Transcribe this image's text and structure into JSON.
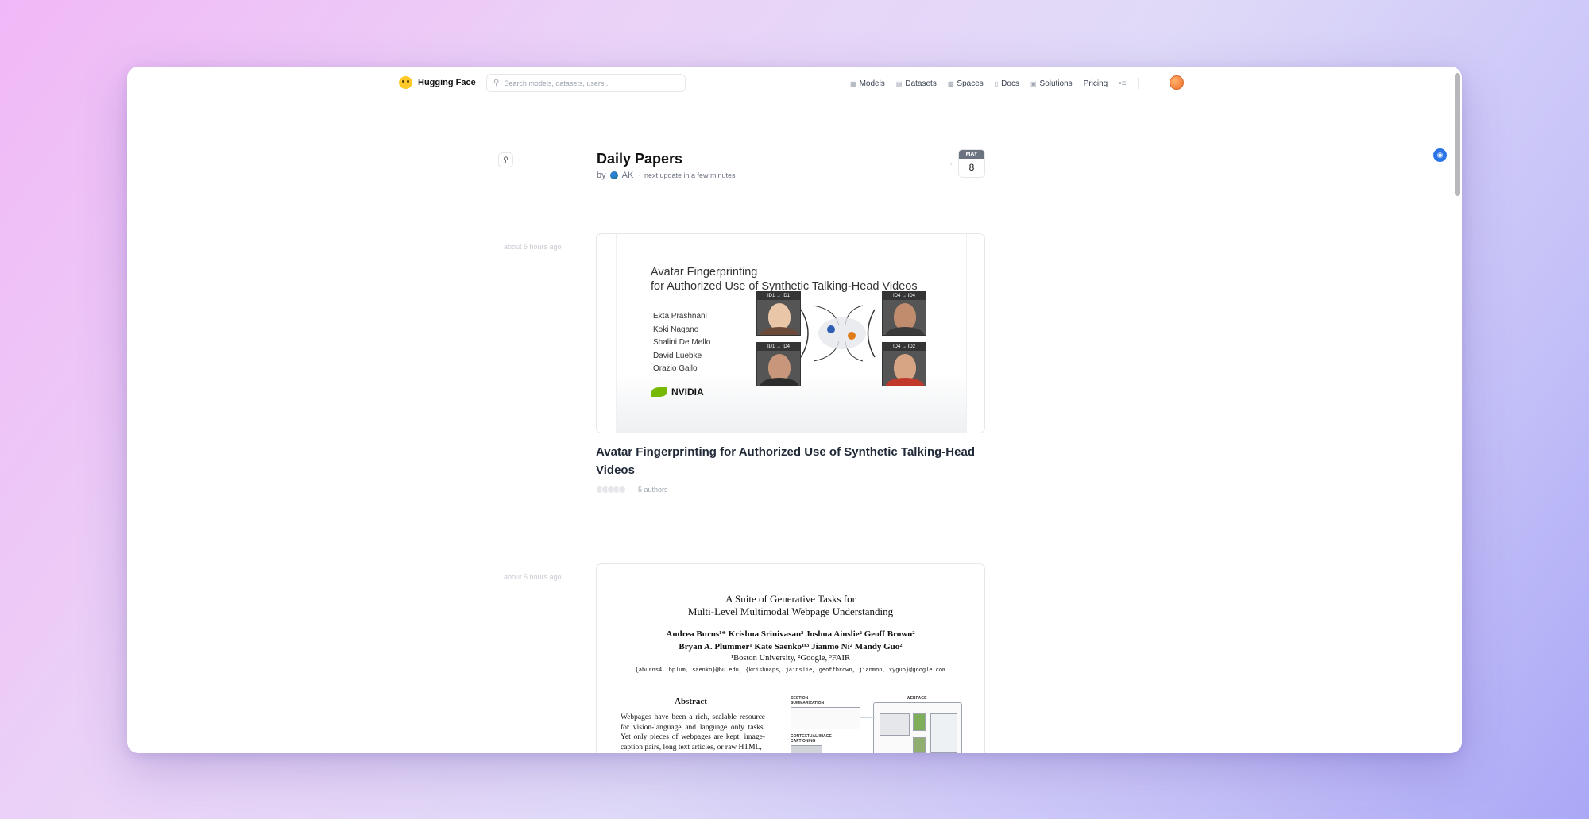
{
  "nav": {
    "brand": "Hugging Face",
    "search_placeholder": "Search models, datasets, users...",
    "links": [
      {
        "label": "Models",
        "icon": "cube-icon"
      },
      {
        "label": "Datasets",
        "icon": "database-icon"
      },
      {
        "label": "Spaces",
        "icon": "grid-icon"
      },
      {
        "label": "Docs",
        "icon": "doc-icon"
      },
      {
        "label": "Solutions",
        "icon": "briefcase-icon"
      },
      {
        "label": "Pricing",
        "icon": ""
      }
    ],
    "more": "•≡"
  },
  "header": {
    "title": "Daily Papers",
    "by": "by",
    "author": "AK",
    "separator": "·",
    "update": "next update in a few minutes"
  },
  "date": {
    "prev": "‹",
    "month": "MAY",
    "day": "8"
  },
  "papers": [
    {
      "ago": "about 5 hours ago",
      "title": "Avatar Fingerprinting for Authorized Use of Synthetic Talking-Head Videos",
      "authors_count": "5 authors",
      "separator": "·",
      "thumbnail": {
        "line1": "Avatar Fingerprinting",
        "line2": "for Authorized Use of Synthetic Talking-Head Videos",
        "authors": [
          "Ekta Prashnani",
          "Koki Nagano",
          "Shalini De Mello",
          "David Luebke",
          "Orazio Gallo"
        ],
        "logo": "NVIDIA",
        "face_labels": [
          "ID1 → ID1",
          "ID1 → ID4",
          "ID4 → ID4",
          "ID4 → ID2"
        ]
      }
    },
    {
      "ago": "about 5 hours ago",
      "thumbnail": {
        "title_line1": "A Suite of Generative Tasks for",
        "title_line2": "Multi-Level Multimodal Webpage Understanding",
        "authors_line1": "Andrea Burns¹*   Krishna Srinivasan²   Joshua Ainslie²   Geoff Brown²",
        "authors_line2": "Bryan A. Plummer¹   Kate Saenko¹ʳ³   Jianmo Ni²   Mandy Guo²",
        "affiliations": "¹Boston University, ²Google, ³FAIR",
        "emails": "{aburns4, bplum, saenko}@bu.edu, {krishnaps, jainslie, geoffbrown, jianmon, xyguo}@google.com",
        "abstract_heading": "Abstract",
        "abstract_text": "Webpages have been a rich, scalable resource for vision-language and language only tasks. Yet only pieces of webpages are kept: image-caption pairs, long text articles, or raw HTML,",
        "fig_labels": [
          "SECTION SUMMARIZATION",
          "CONTEXTUAL IMAGE CAPTIONING",
          "WEBPAGE"
        ]
      }
    }
  ]
}
